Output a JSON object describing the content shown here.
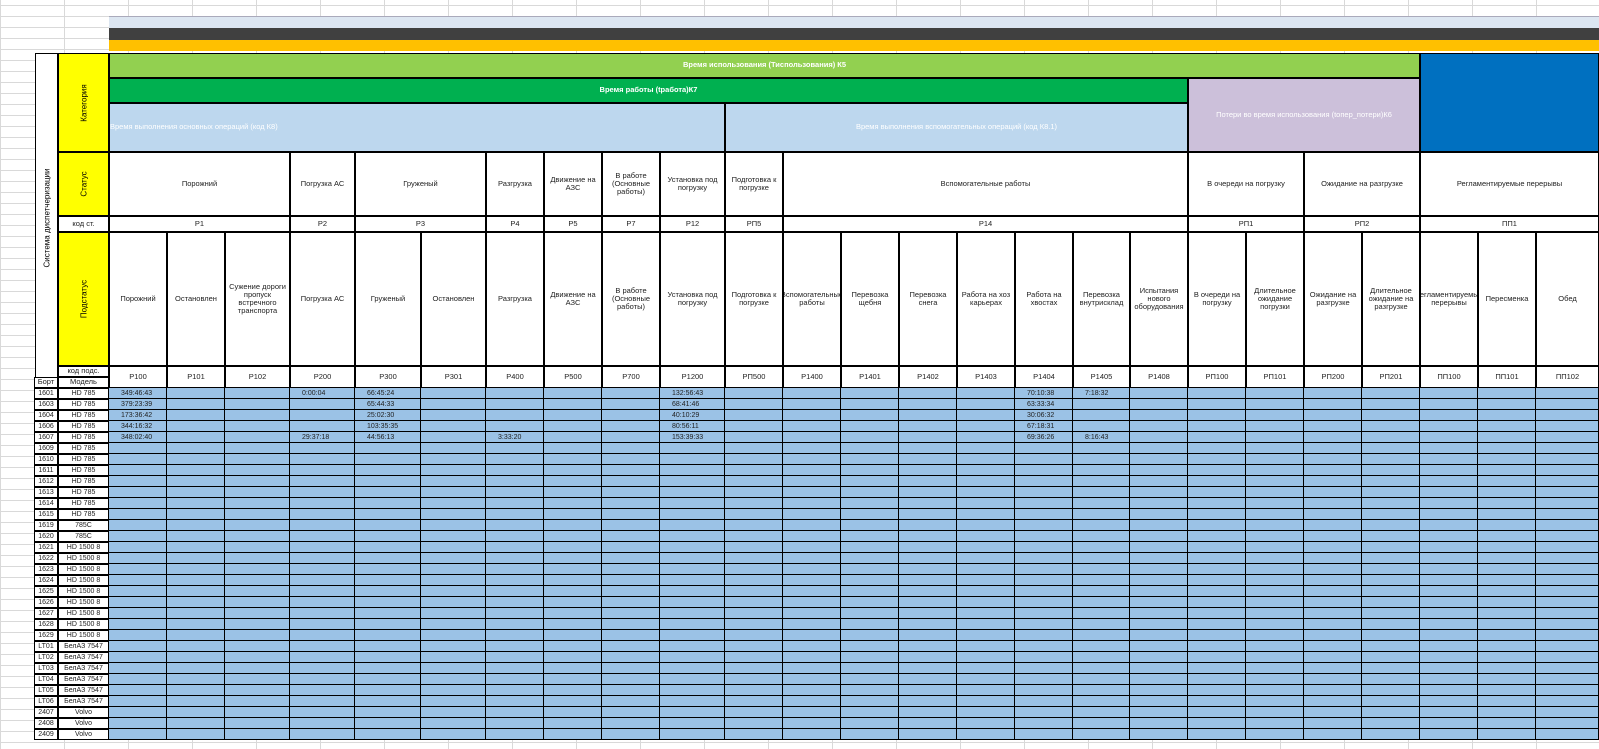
{
  "colors": {
    "yellow": "#ffff00",
    "light_green": "#92d050",
    "green": "#00b050",
    "light_blue": "#bdd7ee",
    "purple": "#ccc0da",
    "blue": "#0070c0",
    "orange": "#ffc000",
    "dark_gray": "#404040",
    "data_fill": "#9bc2e6"
  },
  "left_labels": {
    "system": "Система диспетчеризации",
    "category": "Категория",
    "status": "Статус",
    "code_st": "код ст.",
    "substatus": "Подстатус",
    "code_sub": "код подс.",
    "bort": "Борт",
    "model": "Модель"
  },
  "bands": {
    "usage": "Время использования (Тиспользования) К5",
    "work": "Время работы (tработа)К7",
    "main_ops": "Время выполнения основных операций (код К8)",
    "aux_ops": "Время выполнения вспомогательных операций (код К8.1)",
    "losses": "Потери во время использования (tопер_потери)К6"
  },
  "statuses": [
    {
      "name": "Порожний",
      "code": "P1"
    },
    {
      "name": "Погрузка АС",
      "code": "P2"
    },
    {
      "name": "Груженый",
      "code": "P3"
    },
    {
      "name": "Разгрузка",
      "code": "P4"
    },
    {
      "name": "Движение на АЗС",
      "code": "P5"
    },
    {
      "name": "В работе (Основные работы)",
      "code": "P7"
    },
    {
      "name": "Установка под погрузку",
      "code": "P12"
    },
    {
      "name": "Подготовка к погрузке",
      "code": "РП5"
    },
    {
      "name": "Вспомогательные работы",
      "code": "P14"
    },
    {
      "name": "В очереди на погрузку",
      "code": "РП1"
    },
    {
      "name": "Ожидание на разгрузке",
      "code": "РП2"
    },
    {
      "name": "Регламентируемые перерывы",
      "code": "ПП1"
    }
  ],
  "substatuses": [
    {
      "name": "Порожний",
      "code": "P100"
    },
    {
      "name": "Остановлен",
      "code": "P101"
    },
    {
      "name": "Сужение дороги пропуск встречного транспорта",
      "code": "P102"
    },
    {
      "name": "Погрузка АС",
      "code": "P200"
    },
    {
      "name": "Груженый",
      "code": "P300"
    },
    {
      "name": "Остановлен",
      "code": "P301"
    },
    {
      "name": "Разгрузка",
      "code": "P400"
    },
    {
      "name": "Движение на АЗС",
      "code": "P500"
    },
    {
      "name": "В работе (Основные работы)",
      "code": "P700"
    },
    {
      "name": "Установка под погрузку",
      "code": "P1200"
    },
    {
      "name": "Подготовка к погрузке",
      "code": "РП500"
    },
    {
      "name": "Вспомогательные работы",
      "code": "P1400"
    },
    {
      "name": "Перевозка щебня",
      "code": "P1401"
    },
    {
      "name": "Перевозка снега",
      "code": "P1402"
    },
    {
      "name": "Работа на хоз карьерах",
      "code": "P1403"
    },
    {
      "name": "Работа на хвостах",
      "code": "P1404"
    },
    {
      "name": "Перевозка внутрисклад",
      "code": "P1405"
    },
    {
      "name": "Испытания нового оборудования",
      "code": "P1408"
    },
    {
      "name": "В очереди на погрузку",
      "code": "РП100"
    },
    {
      "name": "Длительное ожидание погрузки",
      "code": "РП101"
    },
    {
      "name": "Ожидание на разгрузке",
      "code": "РП200"
    },
    {
      "name": "Длительное ожидание на разгрузке",
      "code": "РП201"
    },
    {
      "name": "Регламентируемые перерывы",
      "code": "ПП100"
    },
    {
      "name": "Пересменка",
      "code": "ПП101"
    },
    {
      "name": "Обед",
      "code": "ПП102"
    }
  ],
  "rows": [
    {
      "bort": "1601",
      "model": "HD 785",
      "values": {
        "P100": "349:46:43",
        "P200": "0:00:04",
        "P300": "66:45:24",
        "P1200": "132:56:43",
        "P1404": "70:10:38",
        "P1405": "7:18:32"
      }
    },
    {
      "bort": "1603",
      "model": "HD 785",
      "values": {
        "P100": "379:23:39",
        "P300": "65:44:33",
        "P1200": "68:41:46",
        "P1404": "63:33:34"
      }
    },
    {
      "bort": "1604",
      "model": "HD 785",
      "values": {
        "P100": "173:36:42",
        "P300": "25:02:30",
        "P1200": "40:10:29",
        "P1404": "30:06:32"
      }
    },
    {
      "bort": "1606",
      "model": "HD 785",
      "values": {
        "P100": "344:16:32",
        "P300": "103:35:35",
        "P1200": "80:56:11",
        "P1404": "67:18:31"
      }
    },
    {
      "bort": "1607",
      "model": "HD 785",
      "values": {
        "P100": "348:02:40",
        "P200": "29:37:18",
        "P300": "44:56:13",
        "P400": "3:33:20",
        "P1200": "153:39:33",
        "P1404": "69:36:26",
        "P1405": "8:16:43"
      }
    },
    {
      "bort": "1609",
      "model": "HD 785",
      "values": {}
    },
    {
      "bort": "1610",
      "model": "HD 785",
      "values": {}
    },
    {
      "bort": "1611",
      "model": "HD 785",
      "values": {}
    },
    {
      "bort": "1612",
      "model": "HD 785",
      "values": {}
    },
    {
      "bort": "1613",
      "model": "HD 785",
      "values": {}
    },
    {
      "bort": "1614",
      "model": "HD 785",
      "values": {}
    },
    {
      "bort": "1615",
      "model": "HD 785",
      "values": {}
    },
    {
      "bort": "1619",
      "model": "785C",
      "values": {}
    },
    {
      "bort": "1620",
      "model": "785C",
      "values": {}
    },
    {
      "bort": "1621",
      "model": "HD 1500 8",
      "values": {}
    },
    {
      "bort": "1622",
      "model": "HD 1500 8",
      "values": {}
    },
    {
      "bort": "1623",
      "model": "HD 1500 8",
      "values": {}
    },
    {
      "bort": "1624",
      "model": "HD 1500 8",
      "values": {}
    },
    {
      "bort": "1625",
      "model": "HD 1500 8",
      "values": {}
    },
    {
      "bort": "1626",
      "model": "HD 1500 8",
      "values": {}
    },
    {
      "bort": "1627",
      "model": "HD 1500 8",
      "values": {}
    },
    {
      "bort": "1628",
      "model": "HD 1500 8",
      "values": {}
    },
    {
      "bort": "1629",
      "model": "HD 1500 8",
      "values": {}
    },
    {
      "bort": "LT01",
      "model": "БелАЗ 7547",
      "values": {}
    },
    {
      "bort": "LT02",
      "model": "БелАЗ 7547",
      "values": {}
    },
    {
      "bort": "LT03",
      "model": "БелАЗ 7547",
      "values": {}
    },
    {
      "bort": "LT04",
      "model": "БелАЗ 7547",
      "values": {}
    },
    {
      "bort": "LT05",
      "model": "БелАЗ 7547",
      "values": {}
    },
    {
      "bort": "LT06",
      "model": "БелАЗ 7547",
      "values": {}
    },
    {
      "bort": "2407",
      "model": "Volvo",
      "values": {}
    },
    {
      "bort": "2408",
      "model": "Volvo",
      "values": {}
    },
    {
      "bort": "2409",
      "model": "Volvo",
      "values": {}
    }
  ]
}
